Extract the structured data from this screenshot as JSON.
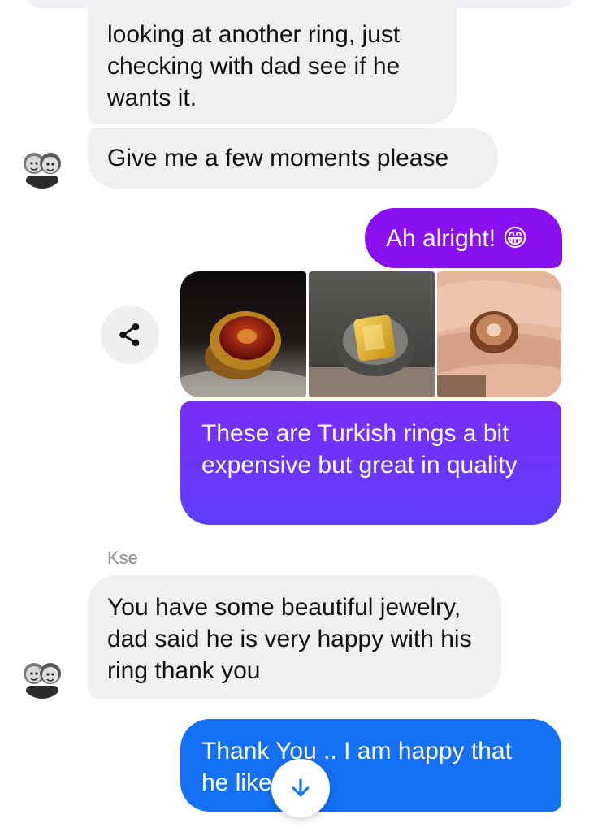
{
  "thread": {
    "messages": [
      {
        "from": "them",
        "text": "looking at another ring, just checking with dad see if he wants it."
      },
      {
        "from": "them",
        "text": "Give me a few moments please"
      },
      {
        "from": "me",
        "text": "Ah alright! 😁"
      },
      {
        "from": "me",
        "text": "These are Turkish rings a bit expensive but great in quality"
      },
      {
        "from": "them",
        "sender": "Kse",
        "text": "You have some beautiful jewelry, dad said he is very happy with his ring thank you"
      },
      {
        "from": "me",
        "text": "Thank You .. I am happy that he liked 👍"
      }
    ],
    "photos": [
      "red-stone-gold-ring",
      "citrine-silver-ring",
      "ring-on-hand"
    ]
  },
  "icons": {
    "share": "share-icon",
    "scroll_down": "arrow-down-icon"
  },
  "colors": {
    "incoming_bubble": "#f0f0f0",
    "outgoing_purple": "#8a10f0",
    "outgoing_violet": "#6a35ff",
    "outgoing_blue": "#1470f5"
  }
}
